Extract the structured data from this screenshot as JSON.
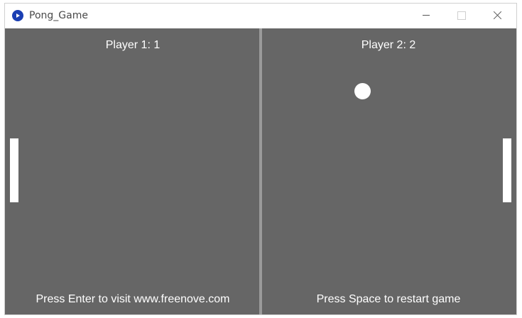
{
  "window": {
    "title": "Pong_Game",
    "icon": "python-icon"
  },
  "scores": {
    "player1": "Player 1: 1",
    "player2": "Player 2: 2"
  },
  "hints": {
    "left": "Press Enter to visit www.freenove.com",
    "right": "Press Space to restart game"
  },
  "colors": {
    "background": "#666666",
    "net": "#9a9a9a",
    "foreground": "#ffffff"
  }
}
